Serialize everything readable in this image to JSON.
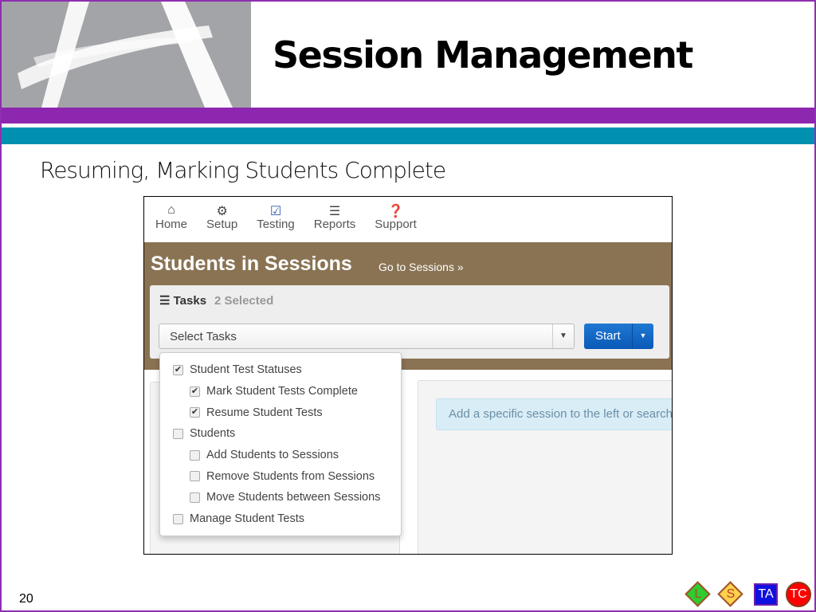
{
  "slide": {
    "title": "Session Management",
    "subtitle": "Resuming, Marking Students Complete",
    "page_number": "20"
  },
  "nav": [
    {
      "label": "Home",
      "icon": "home-icon"
    },
    {
      "label": "Setup",
      "icon": "gear-icon"
    },
    {
      "label": "Testing",
      "icon": "checkbox-icon"
    },
    {
      "label": "Reports",
      "icon": "list-icon"
    },
    {
      "label": "Support",
      "icon": "question-icon"
    }
  ],
  "page": {
    "heading": "Students in Sessions",
    "go_link": "Go to Sessions »"
  },
  "tasks": {
    "label": "Tasks",
    "selected": "2 Selected",
    "select_placeholder": "Select Tasks",
    "start": "Start"
  },
  "options": [
    {
      "label": "Student Test Statuses",
      "checked": true,
      "level": 0
    },
    {
      "label": "Mark Student Tests Complete",
      "checked": true,
      "level": 1
    },
    {
      "label": "Resume Student Tests",
      "checked": true,
      "level": 1
    },
    {
      "label": "Students",
      "checked": false,
      "level": 0
    },
    {
      "label": "Add Students to Sessions",
      "checked": false,
      "level": 1
    },
    {
      "label": "Remove Students from Sessions",
      "checked": false,
      "level": 1
    },
    {
      "label": "Move Students between Sessions",
      "checked": false,
      "level": 1
    },
    {
      "label": "Manage Student Tests",
      "checked": false,
      "level": 0
    }
  ],
  "info": "Add a specific session to the left or search",
  "badges": [
    {
      "label": "L",
      "color": "#2ecc2e"
    },
    {
      "label": "S",
      "color": "#ffd24d"
    },
    {
      "label": "TA",
      "color": "#1010e0"
    },
    {
      "label": "TC",
      "color": "#ff0000"
    }
  ],
  "colors": {
    "purple": "#8e27b0",
    "teal": "#0090b0",
    "brown": "#8a7353",
    "primary": "#0a59b8"
  }
}
